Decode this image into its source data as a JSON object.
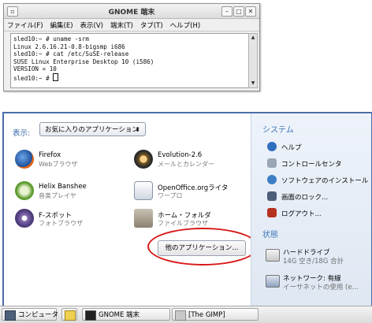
{
  "terminal": {
    "title": "GNOME 端末",
    "menu": [
      "ファイル(F)",
      "編集(E)",
      "表示(V)",
      "端末(T)",
      "タブ(T)",
      "ヘルプ(H)"
    ],
    "lines": [
      "sled10:~ # uname -srm",
      "Linux 2.6.16.21-0.8-bigsmp i686",
      "sled10:~ # cat /etc/SuSE-release",
      "SUSE Linux Enterprise Desktop 10 (i586)",
      "VERSION = 10",
      "sled10:~ # "
    ]
  },
  "menu": {
    "show_label": "表示:",
    "filter_value": "お気に入りのアプリケーション",
    "apps": [
      {
        "name": "Firefox",
        "desc": "Webブラウザ"
      },
      {
        "name": "Evolution-2.6",
        "desc": "メールとカレンダー"
      },
      {
        "name": "Helix Banshee",
        "desc": "音楽プレイヤ"
      },
      {
        "name": "OpenOffice.orgライタ",
        "desc": "ワープロ"
      },
      {
        "name": "F-スポット",
        "desc": "フォトブラウザ"
      },
      {
        "name": "ホーム・フォルダ",
        "desc": "ファイルブラウザ"
      }
    ],
    "more_button": "他のアプリケーション...",
    "system_heading": "システム",
    "system_items": [
      "ヘルプ",
      "コントロールセンタ",
      "ソフトウェアのインストール",
      "画面のロック...",
      "ログアウト..."
    ],
    "status_heading": "状態",
    "status_items": [
      {
        "name": "ハードドライブ",
        "detail": "14G 空き/18G 合計"
      },
      {
        "name": "ネットワーク: 有線",
        "detail": "イーサネットの使用 (e..."
      }
    ]
  },
  "taskbar": {
    "computer": "コンピュータ",
    "items": [
      "GNOME 端末",
      "[The GIMP]"
    ]
  }
}
